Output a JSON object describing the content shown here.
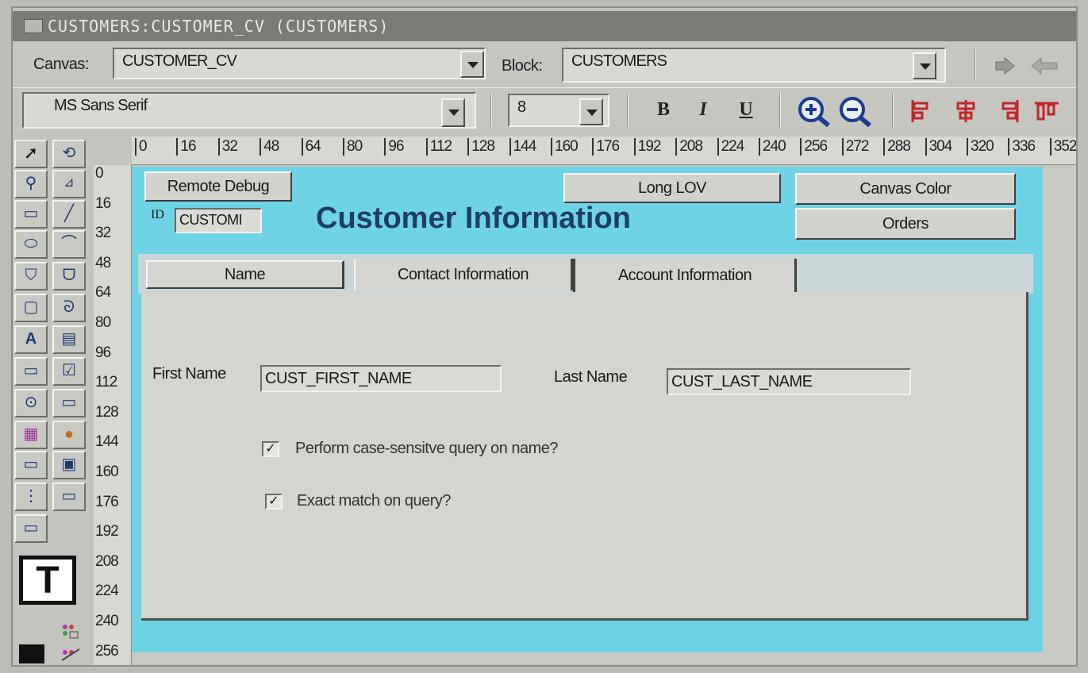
{
  "window": {
    "title": "CUSTOMERS:CUSTOMER_CV (CUSTOMERS)"
  },
  "toolbar1": {
    "canvas_label": "Canvas:",
    "canvas_value": "CUSTOMER_CV",
    "block_label": "Block:",
    "block_value": "CUSTOMERS"
  },
  "toolbar2": {
    "font_value": "MS Sans Serif",
    "size_value": "8",
    "bold": "B",
    "italic": "I",
    "underline": "U"
  },
  "palette": {
    "text_tool": "T"
  },
  "ruler_h": [
    "0",
    "16",
    "32",
    "48",
    "64",
    "80",
    "96",
    "112",
    "128",
    "144",
    "160",
    "176",
    "192",
    "208",
    "224",
    "240",
    "256",
    "272",
    "288",
    "304",
    "320",
    "336",
    "352"
  ],
  "ruler_v": [
    "0",
    "16",
    "32",
    "48",
    "64",
    "80",
    "96",
    "112",
    "128",
    "144",
    "160",
    "176",
    "192",
    "208",
    "224",
    "240",
    "256"
  ],
  "form": {
    "remote_debug": "Remote Debug",
    "long_lov": "Long LOV",
    "canvas_color": "Canvas Color",
    "orders": "Orders",
    "id_label": "ID",
    "id_value": "CUSTOMI",
    "title": "Customer Information",
    "tabs": [
      "Name",
      "Contact Information",
      "Account Information"
    ],
    "first_name_label": "First Name",
    "first_name_value": "CUST_FIRST_NAME",
    "last_name_label": "Last Name",
    "last_name_value": "CUST_LAST_NAME",
    "case_sensitive_label": "Perform case-sensitve query on name?",
    "case_sensitive_checked": true,
    "exact_match_label": "Exact match on query?",
    "exact_match_checked": true
  },
  "colors": {
    "canvas": "#6fd3e6",
    "title": "#1d3e6a"
  }
}
